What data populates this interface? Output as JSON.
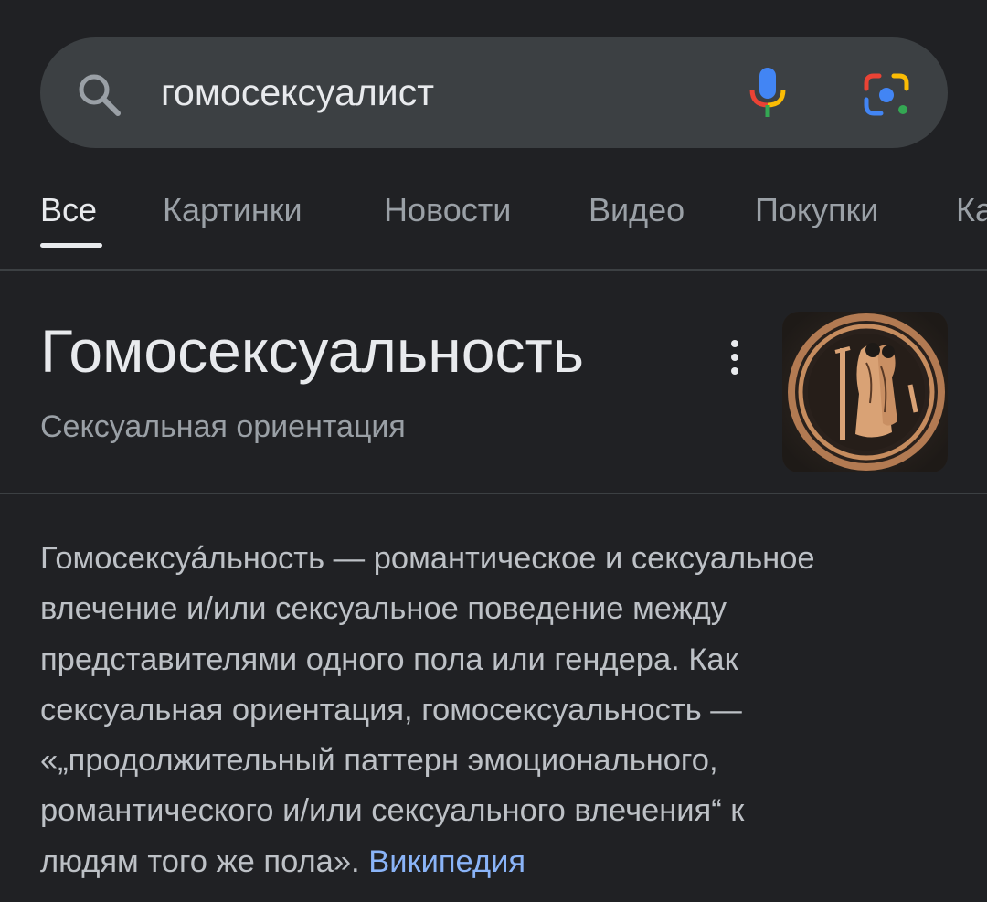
{
  "search": {
    "query": "гомосексуалист"
  },
  "icons": {
    "search": "search-icon",
    "voice": "mic-icon",
    "lens": "google-lens-icon",
    "more": "more-vert-icon"
  },
  "tabs": [
    {
      "label": "Все",
      "active": true
    },
    {
      "label": "Картинки",
      "active": false
    },
    {
      "label": "Новости",
      "active": false
    },
    {
      "label": "Видео",
      "active": false
    },
    {
      "label": "Покупки",
      "active": false
    },
    {
      "label": "Ка",
      "active": false
    }
  ],
  "knowledge_panel": {
    "title": "Гомосексуальность",
    "subtitle": "Сексуальная ориентация",
    "image": "greek-pottery-thumbnail",
    "description_lines": [
      "Гомосексуа́льность — романтическое и сексуальное",
      "влечение и/или сексуальное поведение между",
      "представителями одного пола или гендера. Как",
      "сексуальная ориентация, гомосексуальность —",
      "«„продолжительный паттерн эмоционального,",
      "романтического и/или сексуального влечения“ к",
      "людям того же пола». "
    ],
    "source_link": "Википедия"
  },
  "colors": {
    "background": "#202124",
    "search_bar": "#3c4043",
    "text_primary": "#e8eaed",
    "text_secondary": "#9aa0a6",
    "text_body": "#bdc1c6",
    "link": "#8ab4f8"
  }
}
